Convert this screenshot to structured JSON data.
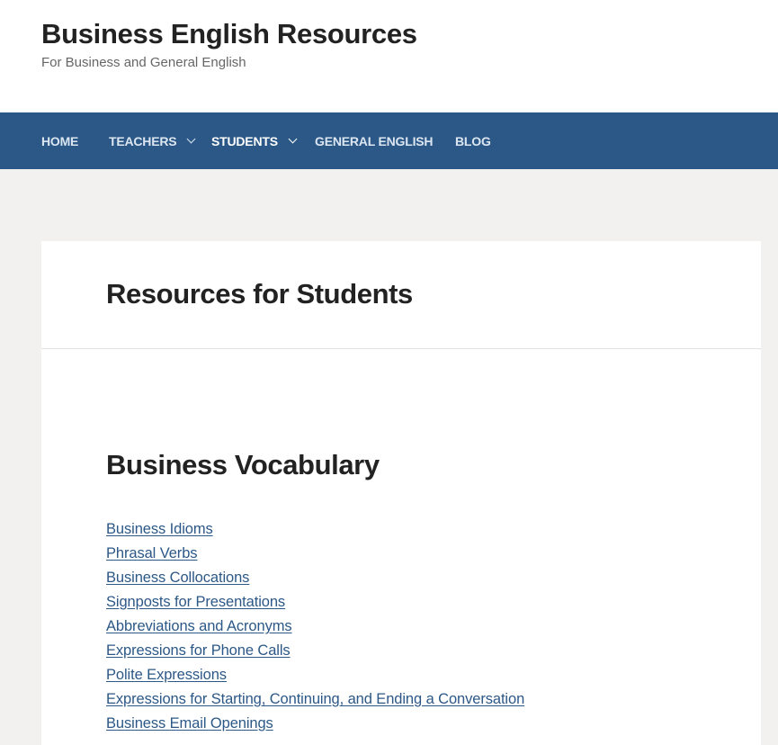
{
  "site": {
    "title": "Business English Resources",
    "tagline": "For Business and General English"
  },
  "nav": {
    "items": [
      {
        "label": "HOME",
        "has_dropdown": false,
        "current": false
      },
      {
        "label": "TEACHERS",
        "has_dropdown": true,
        "current": false
      },
      {
        "label": "STUDENTS",
        "has_dropdown": true,
        "current": true
      },
      {
        "label": "GENERAL ENGLISH",
        "has_dropdown": false,
        "current": false
      },
      {
        "label": "BLOG",
        "has_dropdown": false,
        "current": false
      }
    ]
  },
  "page": {
    "title": "Resources for Students",
    "sections": [
      {
        "heading": "Business Vocabulary",
        "links": [
          "Business Idioms",
          "Phrasal Verbs",
          "Business Collocations",
          "Signposts for Presentations",
          "Abbreviations and Acronyms",
          "Expressions for Phone Calls",
          "Polite Expressions",
          "Expressions for Starting, Continuing, and Ending a Conversation",
          "Business Email Openings"
        ]
      }
    ]
  },
  "colors": {
    "nav_background": "#2c5887",
    "page_background": "#f2f1f0",
    "link": "#2c5887"
  }
}
